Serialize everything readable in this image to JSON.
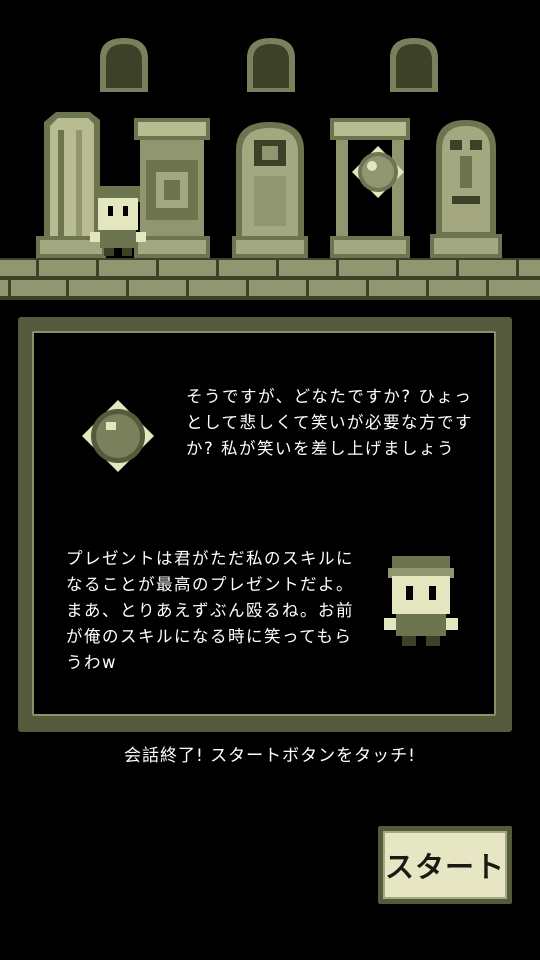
{
  "dialog": {
    "speaker1_text": "そうですが、どなたですか? ひょっとして悲しくて笑いが必要な方ですか? 私が笑いを差し上げましょう",
    "speaker2_text": "プレゼントは君がただ私のスキルになることが最高のプレゼントだよ。まあ、とりあえずぶん殴るね。お前が俺のスキルになる時に笑ってもらうわw"
  },
  "instruction": "会話終了!  スタートボタンをタッチ!",
  "start_button": {
    "label": "スタート"
  },
  "palette": {
    "dark": "#3c4128",
    "mid": "#6c7450",
    "light": "#b8bc90",
    "pale": "#e4e6c0"
  }
}
